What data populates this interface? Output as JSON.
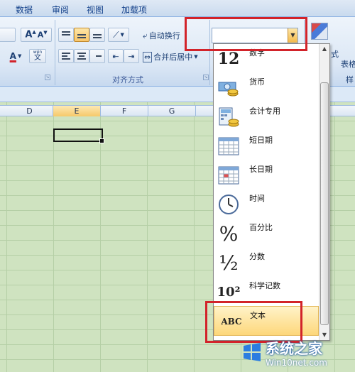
{
  "tabs": [
    "数据",
    "审阅",
    "视图",
    "加载项"
  ],
  "font_group": {
    "grow_font": "A",
    "shrink_font": "A",
    "font_color": "A",
    "phonetic": "wén"
  },
  "alignment_group": {
    "wrap_text": "自动换行",
    "merge_center": "合并后居中",
    "label": "对齐方式"
  },
  "number_format": {
    "value": ""
  },
  "right_clipped_text": {
    "line1": "式",
    "line2": "表格",
    "line3": "样"
  },
  "columns": [
    "D",
    "E",
    "F",
    "G"
  ],
  "selected_column": "E",
  "format_menu": [
    {
      "label": "数字",
      "icon": "number-icon",
      "glyph": "12"
    },
    {
      "label": "货币",
      "icon": "currency-icon",
      "glyph": ""
    },
    {
      "label": "会计专用",
      "icon": "accounting-icon",
      "glyph": ""
    },
    {
      "label": "短日期",
      "icon": "short-date-icon",
      "glyph": ""
    },
    {
      "label": "长日期",
      "icon": "long-date-icon",
      "glyph": ""
    },
    {
      "label": "时间",
      "icon": "clock-icon",
      "glyph": ""
    },
    {
      "label": "百分比",
      "icon": "percent-icon",
      "glyph": "%"
    },
    {
      "label": "分数",
      "icon": "fraction-icon",
      "glyph": "½"
    },
    {
      "label": "科学记数",
      "icon": "scientific-icon",
      "glyph": "10²"
    },
    {
      "label": "文本",
      "icon": "text-abc-icon",
      "glyph": "ABC"
    }
  ],
  "highlighted_item": "文本",
  "watermark": {
    "title": "系统之家",
    "url": "Win10net.com"
  },
  "colors": {
    "highlight": "#d2232a",
    "accent": "#f8c66a"
  }
}
